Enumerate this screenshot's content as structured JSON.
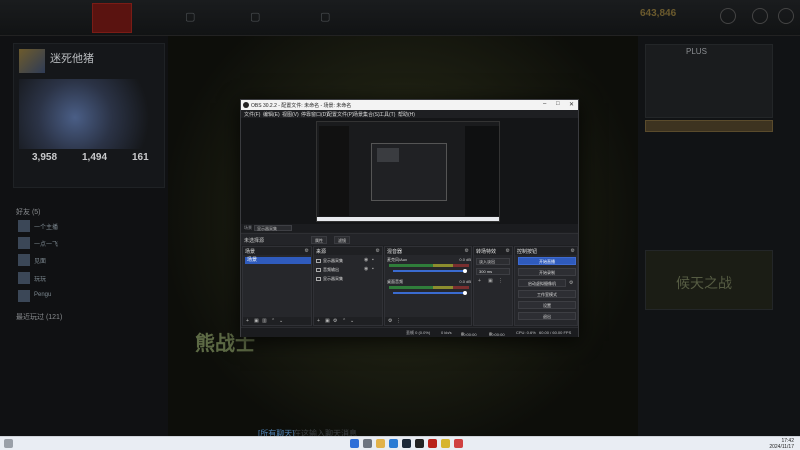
{
  "colors": {
    "accent": "#2f5bbd",
    "dota_red": "#5a1310",
    "gold": "#6b5a2d"
  },
  "dota": {
    "gold": "643,846",
    "profile_name": "迷死他猪",
    "stats": [
      "3,958",
      "1,494",
      "161"
    ],
    "friends_section": "好友 (5)",
    "friends": [
      {
        "name": "一个主播"
      },
      {
        "name": "一点一飞"
      },
      {
        "name": "见面"
      },
      {
        "name": "玩玩"
      },
      {
        "name": "Pengu"
      }
    ],
    "section2": "最近玩过 (121)",
    "hero_name": "熊战士",
    "right_title": "PLUS",
    "right_banner": "候天之战"
  },
  "obs": {
    "title": "OBS 30.2.2 - 配置文件: 未命名 - 场景: 未命名",
    "menu": [
      "文件(F)",
      "编辑(E)",
      "视图(V)",
      "停靠窗口(D)",
      "配置文件(P)",
      "场景集合(S)",
      "工具(T)",
      "帮助(H)"
    ],
    "scene_label": "场景",
    "scene_value": "显示器采集",
    "controls_label": "未选择源",
    "properties_label": "属性",
    "filters_label": "滤镜",
    "docks": {
      "scenes": "场景",
      "sources": "来源",
      "mixer": "混音器",
      "transitions": "转场特效",
      "controls": "控制按钮"
    },
    "scene_items": [
      "场景"
    ],
    "sources": [
      "显示器采集",
      "音频输出",
      "显示器采集"
    ],
    "mixer": [
      {
        "name": "麦克风/Aux",
        "db": "0.0 dB"
      },
      {
        "name": "桌面音频",
        "db": "0.0 dB"
      }
    ],
    "transition": "淡入淡出",
    "duration": "300 ms",
    "control_buttons": [
      "开始直播",
      "开始录制",
      "启动虚拟摄像机",
      "工作室模式",
      "设置",
      "退出"
    ],
    "status": {
      "dropped": "丢帧 0 (0.0%)",
      "bitrate": "0 kb/s",
      "live_time": "00:00:00",
      "rec_time": "00:00:00",
      "cpu": "CPU: 0.6%",
      "fps": "60.00 / 60.00 FPS"
    }
  },
  "chat": {
    "prefix": "[所有聊天]",
    "placeholder": "在这输入聊天消息"
  },
  "taskbar": {
    "time": "17:42",
    "date": "2024/11/17"
  }
}
